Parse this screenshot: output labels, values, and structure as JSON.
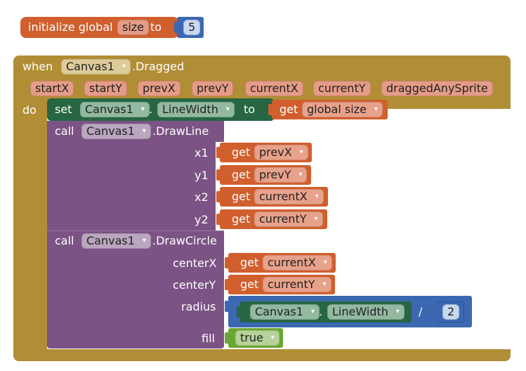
{
  "global_var": {
    "label": "initialize global",
    "name": "size",
    "to": "to",
    "value": "5"
  },
  "event": {
    "when": "when",
    "component": "Canvas1",
    "event_name": ".Dragged",
    "params": [
      "startX",
      "startY",
      "prevX",
      "prevY",
      "currentX",
      "currentY",
      "draggedAnySprite"
    ],
    "do": "do"
  },
  "set_block": {
    "set": "set",
    "component": "Canvas1",
    "dot": ".",
    "property": "LineWidth",
    "to": "to",
    "get": "get",
    "get_var": "global size"
  },
  "drawline": {
    "call": "call",
    "component": "Canvas1",
    "method": ".DrawLine",
    "args": [
      {
        "label": "x1",
        "get": "get",
        "var": "prevX"
      },
      {
        "label": "y1",
        "get": "get",
        "var": "prevY"
      },
      {
        "label": "x2",
        "get": "get",
        "var": "currentX"
      },
      {
        "label": "y2",
        "get": "get",
        "var": "currentY"
      }
    ]
  },
  "drawcircle": {
    "call": "call",
    "component": "Canvas1",
    "method": ".DrawCircle",
    "centerX_label": "centerX",
    "centerX_get": "get",
    "centerX_var": "currentX",
    "centerY_label": "centerY",
    "centerY_get": "get",
    "centerY_var": "currentY",
    "radius_label": "radius",
    "radius_component": "Canvas1",
    "radius_dot": ".",
    "radius_property": "LineWidth",
    "divide": "/",
    "divisor": "2",
    "fill_label": "fill",
    "fill_value": "true"
  },
  "dropdown_arrow": "▾",
  "colors": {
    "variables": "#D05F2D",
    "event": "#B18E35",
    "setter": "#266643",
    "method": "#7C5385",
    "math": "#3B68B1",
    "logic": "#6CA534"
  }
}
